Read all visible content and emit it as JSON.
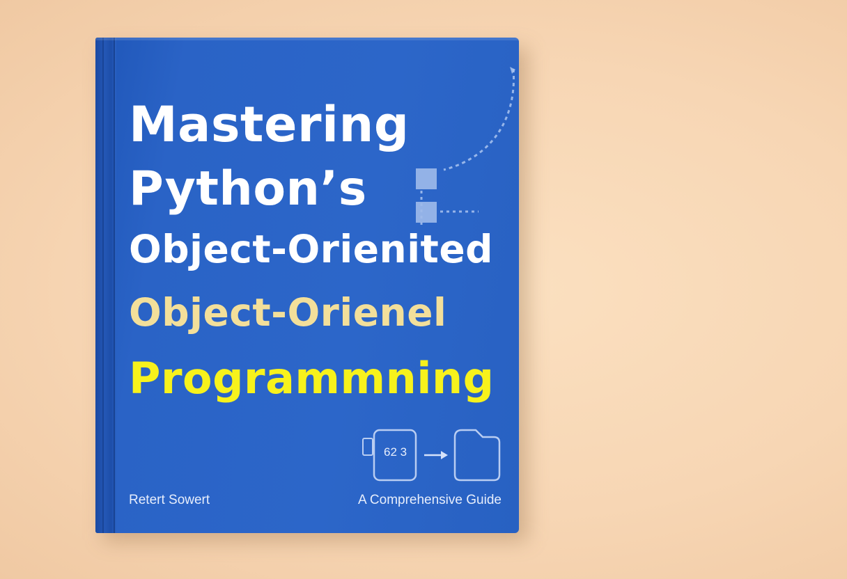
{
  "book": {
    "title_lines": [
      "Mastering",
      "Python’s",
      "Object-Orienited",
      "Object-Orienel",
      "Programmning"
    ],
    "author": "Retert Sowert",
    "subtitle": "A Comprehensive Guide",
    "diagram_label": "62 3"
  },
  "colors": {
    "background": "#f7d6b4",
    "cover": "#2c66c9",
    "title_white": "#ffffff",
    "title_cream": "#f3df9a",
    "title_yellow": "#f7f21c"
  },
  "icons": {
    "top_diagram": "connector-diagram-icon",
    "bottom_diagram": "object-transform-icon"
  }
}
